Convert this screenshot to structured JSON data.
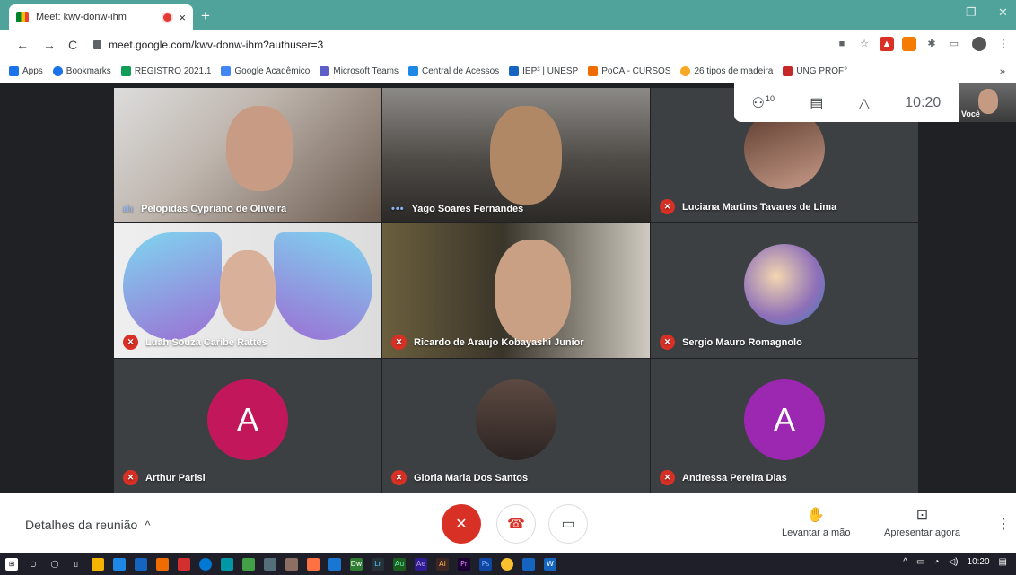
{
  "browser": {
    "tab_title": "Meet: kwv-donw-ihm",
    "close": "×",
    "newtab": "+",
    "url": "meet.google.com/kwv-donw-ihm?authuser=3",
    "minimize": "—",
    "restore": "❐",
    "close_window": "✕"
  },
  "bookmarks": {
    "items": [
      "Apps",
      "Bookmarks",
      "REGISTRO 2021.1",
      "Google Acadêmico",
      "Microsoft Teams",
      "Central de Acessos",
      "IEP³ | UNESP",
      "PoCA - CURSOS",
      "26 tipos de madeira",
      "UNG PROF°"
    ],
    "more": "»"
  },
  "participants": [
    {
      "name": "Pelopidas Cypriano de Oliveira",
      "state": "speaking"
    },
    {
      "name": "Yago Soares Fernandes",
      "state": "speaking"
    },
    {
      "name": "Luciana Martins Tavares de Lima",
      "state": "muted"
    },
    {
      "name": "Luah Souza Caribe Rattes",
      "state": "muted"
    },
    {
      "name": "Ricardo de Araujo Kobayashi Junior",
      "state": "muted"
    },
    {
      "name": "Sergio Mauro Romagnolo",
      "state": "muted"
    },
    {
      "name": "Arthur Parisi",
      "state": "muted",
      "letter": "A",
      "color": "#c2185b"
    },
    {
      "name": "Gloria Maria Dos Santos",
      "state": "muted"
    },
    {
      "name": "Andressa Pereira Dias",
      "state": "muted",
      "letter": "A",
      "color": "#9c27b0"
    }
  ],
  "topbar": {
    "people_count": "10",
    "time": "10:20",
    "self_label": "Você"
  },
  "bottom": {
    "details": "Detalhes da reunião",
    "details_chevron": "^",
    "raise_hand": "Levantar a mão",
    "present": "Apresentar agora"
  },
  "taskbar": {
    "time": "10:20"
  }
}
